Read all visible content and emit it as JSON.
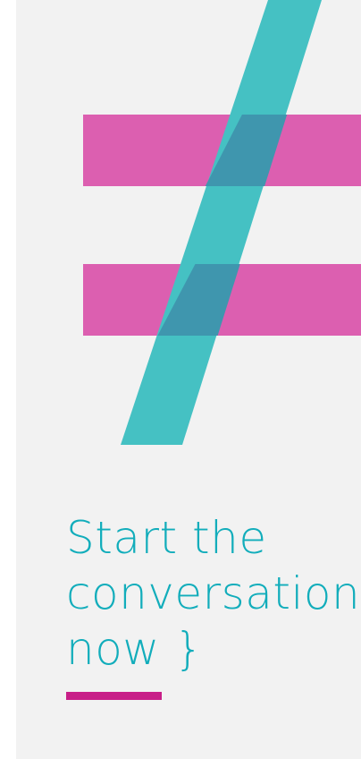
{
  "headline": {
    "text": "Start the\nconversation\nnow }"
  },
  "colors": {
    "teal": "#45c1c3",
    "magenta": "#dc5fb0",
    "overlap": "#3f96ae",
    "headline": "#12adbb",
    "underline": "#c81f88",
    "panel": "#f2f2f2"
  },
  "graphic": {
    "icon": "not-equal-sign-icon"
  }
}
